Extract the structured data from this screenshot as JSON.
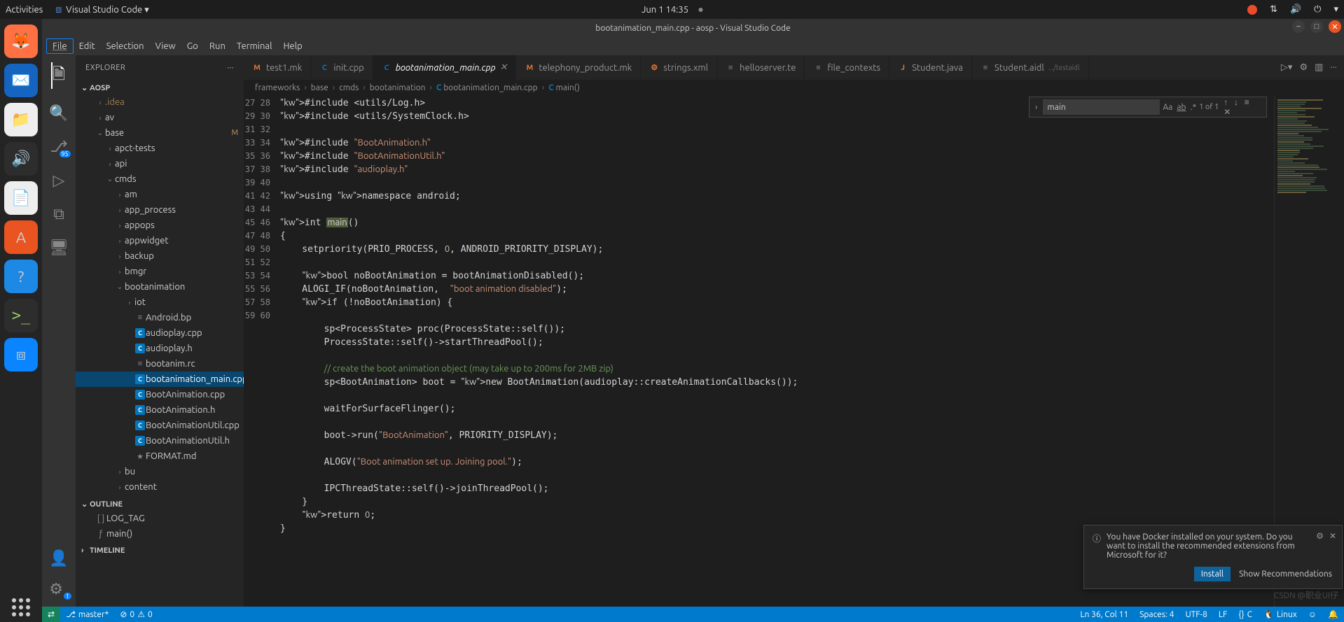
{
  "gnome": {
    "activities": "Activities",
    "app": "Visual Studio Code",
    "datetime": "Jun 1  14:35"
  },
  "titlebar": "bootanimation_main.cpp - aosp - Visual Studio Code",
  "menu": [
    "File",
    "Edit",
    "Selection",
    "View",
    "Go",
    "Run",
    "Terminal",
    "Help"
  ],
  "explorer": {
    "title": "EXPLORER",
    "project": "AOSP"
  },
  "scm_badge": "95",
  "gear_badge": "1",
  "tree": [
    {
      "d": 2,
      "t": "folder",
      "label": ".idea",
      "cls": "dotname",
      "chev": ">"
    },
    {
      "d": 2,
      "t": "folder",
      "label": "av",
      "chev": ">"
    },
    {
      "d": 2,
      "t": "folder",
      "label": "base",
      "chev": "v",
      "badge": "M"
    },
    {
      "d": 3,
      "t": "folder",
      "label": "apct-tests",
      "chev": ">"
    },
    {
      "d": 3,
      "t": "folder",
      "label": "api",
      "chev": ">"
    },
    {
      "d": 3,
      "t": "folder",
      "label": "cmds",
      "chev": "v"
    },
    {
      "d": 4,
      "t": "folder",
      "label": "am",
      "chev": ">"
    },
    {
      "d": 4,
      "t": "folder",
      "label": "app_process",
      "chev": ">"
    },
    {
      "d": 4,
      "t": "folder",
      "label": "appops",
      "chev": ">"
    },
    {
      "d": 4,
      "t": "folder",
      "label": "appwidget",
      "chev": ">"
    },
    {
      "d": 4,
      "t": "folder",
      "label": "backup",
      "chev": ">"
    },
    {
      "d": 4,
      "t": "folder",
      "label": "bmgr",
      "chev": ">"
    },
    {
      "d": 4,
      "t": "folder",
      "label": "bootanimation",
      "chev": "v"
    },
    {
      "d": 5,
      "t": "folder",
      "label": "iot",
      "chev": ">"
    },
    {
      "d": 5,
      "t": "file",
      "icon": "≡",
      "label": "Android.bp"
    },
    {
      "d": 5,
      "t": "file",
      "icon": "C",
      "label": "audioplay.cpp"
    },
    {
      "d": 5,
      "t": "file",
      "icon": "C",
      "label": "audioplay.h"
    },
    {
      "d": 5,
      "t": "file",
      "icon": "≡",
      "label": "bootanim.rc"
    },
    {
      "d": 5,
      "t": "file",
      "icon": "C",
      "label": "bootanimation_main.cpp",
      "active": true
    },
    {
      "d": 5,
      "t": "file",
      "icon": "C",
      "label": "BootAnimation.cpp"
    },
    {
      "d": 5,
      "t": "file",
      "icon": "C",
      "label": "BootAnimation.h"
    },
    {
      "d": 5,
      "t": "file",
      "icon": "C",
      "label": "BootAnimationUtil.cpp"
    },
    {
      "d": 5,
      "t": "file",
      "icon": "C",
      "label": "BootAnimationUtil.h"
    },
    {
      "d": 5,
      "t": "file",
      "icon": "★",
      "label": "FORMAT.md"
    },
    {
      "d": 4,
      "t": "folder",
      "label": "bu",
      "chev": ">"
    },
    {
      "d": 4,
      "t": "folder",
      "label": "content",
      "chev": ">"
    }
  ],
  "outline": {
    "title": "OUTLINE",
    "items": [
      {
        "icon": "[ ]",
        "label": "LOG_TAG"
      },
      {
        "icon": "ƒ",
        "label": "main()"
      }
    ]
  },
  "timeline": {
    "title": "TIMELINE"
  },
  "tabs": [
    {
      "icon": "M",
      "color": "#e37933",
      "label": "test1.mk"
    },
    {
      "icon": "C",
      "color": "#0277bd",
      "label": "init.cpp"
    },
    {
      "icon": "C",
      "color": "#0277bd",
      "label": "bootanimation_main.cpp",
      "active": true,
      "close": true
    },
    {
      "icon": "M",
      "color": "#e37933",
      "label": "telephony_product.mk"
    },
    {
      "icon": "⚙",
      "color": "#e37933",
      "label": "strings.xml"
    },
    {
      "icon": "≡",
      "color": "#888",
      "label": "helloserver.te"
    },
    {
      "icon": "≡",
      "color": "#888",
      "label": "file_contexts"
    },
    {
      "icon": "J",
      "color": "#e37933",
      "label": "Student.java"
    },
    {
      "icon": "≡",
      "color": "#888",
      "label": "Student.aidl",
      "hint": ".../testaidl"
    }
  ],
  "breadcrumb": [
    "frameworks",
    "base",
    "cmds",
    "bootanimation",
    "bootanimation_main.cpp",
    "main()"
  ],
  "find": {
    "value": "main",
    "result": "1 of 1"
  },
  "code_start_line": 27,
  "code_lines": [
    "#include <utils/Log.h>",
    "#include <utils/SystemClock.h>",
    "",
    "#include \"BootAnimation.h\"",
    "#include \"BootAnimationUtil.h\"",
    "#include \"audioplay.h\"",
    "",
    "using namespace android;",
    "",
    "int main()",
    "{",
    "    setpriority(PRIO_PROCESS, 0, ANDROID_PRIORITY_DISPLAY);",
    "",
    "    bool noBootAnimation = bootAnimationDisabled();",
    "    ALOGI_IF(noBootAnimation,  \"boot animation disabled\");",
    "    if (!noBootAnimation) {",
    "",
    "        sp<ProcessState> proc(ProcessState::self());",
    "        ProcessState::self()->startThreadPool();",
    "",
    "        // create the boot animation object (may take up to 200ms for 2MB zip)",
    "        sp<BootAnimation> boot = new BootAnimation(audioplay::createAnimationCallbacks());",
    "",
    "        waitForSurfaceFlinger();",
    "",
    "        boot->run(\"BootAnimation\", PRIORITY_DISPLAY);",
    "",
    "        ALOGV(\"Boot animation set up. Joining pool.\");",
    "",
    "        IPCThreadState::self()->joinThreadPool();",
    "    }",
    "    return 0;",
    "}",
    ""
  ],
  "notif": {
    "text": "You have Docker installed on your system. Do you want to install the recommended extensions from Microsoft for it?",
    "install": "Install",
    "show": "Show Recommendations"
  },
  "status": {
    "branch": "master*",
    "err": "0",
    "warn": "0",
    "pos": "Ln 36, Col 11",
    "spaces": "Spaces: 4",
    "enc": "UTF-8",
    "eol": "LF",
    "lang": "C",
    "os": "Linux",
    "bell": "🔔"
  },
  "watermark": "CSDN @职业UI仔"
}
